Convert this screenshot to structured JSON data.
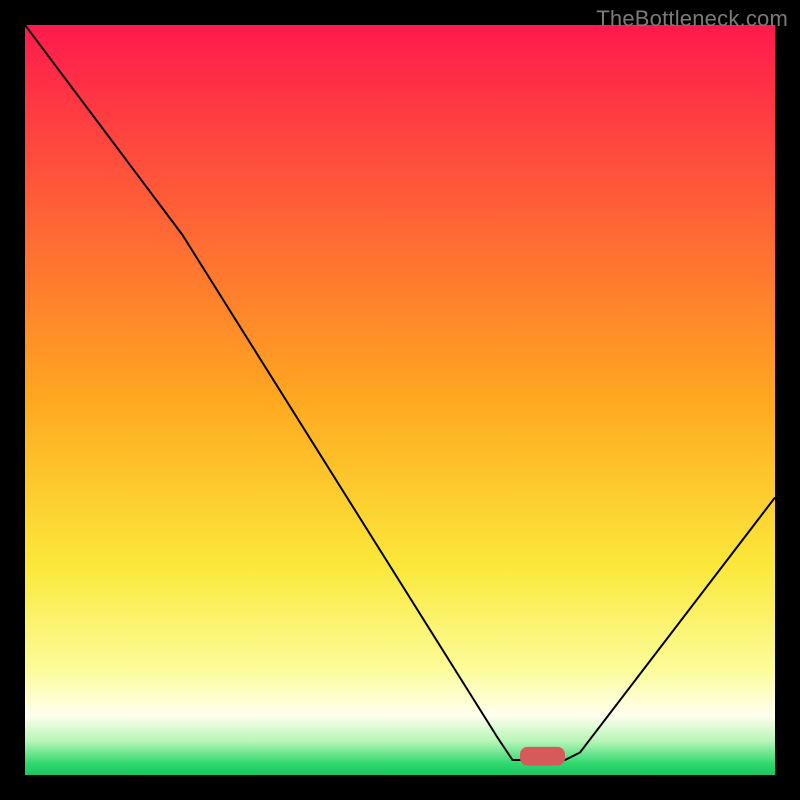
{
  "watermark": "TheBottleneck.com",
  "chart_data": {
    "type": "line",
    "title": "",
    "xlabel": "",
    "ylabel": "",
    "xlim": [
      0,
      100
    ],
    "ylim": [
      0,
      100
    ],
    "grid": false,
    "background_gradient": {
      "direction": "vertical",
      "stops": [
        {
          "offset": 0.0,
          "color": "#ff1a4d"
        },
        {
          "offset": 0.5,
          "color": "#ffa820"
        },
        {
          "offset": 0.72,
          "color": "#fbe83a"
        },
        {
          "offset": 0.86,
          "color": "#fcfc9a"
        },
        {
          "offset": 0.92,
          "color": "#ffffee"
        },
        {
          "offset": 0.955,
          "color": "#b7f5b7"
        },
        {
          "offset": 0.985,
          "color": "#2fd86e"
        },
        {
          "offset": 1.0,
          "color": "#18c85c"
        }
      ]
    },
    "curve": {
      "name": "bottleneck-curve",
      "color": "#000000",
      "points": [
        {
          "x": 0,
          "y": 100
        },
        {
          "x": 21,
          "y": 72
        },
        {
          "x": 63,
          "y": 5
        },
        {
          "x": 65,
          "y": 2
        },
        {
          "x": 72,
          "y": 2
        },
        {
          "x": 74,
          "y": 3
        },
        {
          "x": 100,
          "y": 37
        }
      ]
    },
    "marker": {
      "x": 69,
      "y": 2.5,
      "width": 6,
      "height": 2.5,
      "color": "#d65a5a"
    }
  }
}
